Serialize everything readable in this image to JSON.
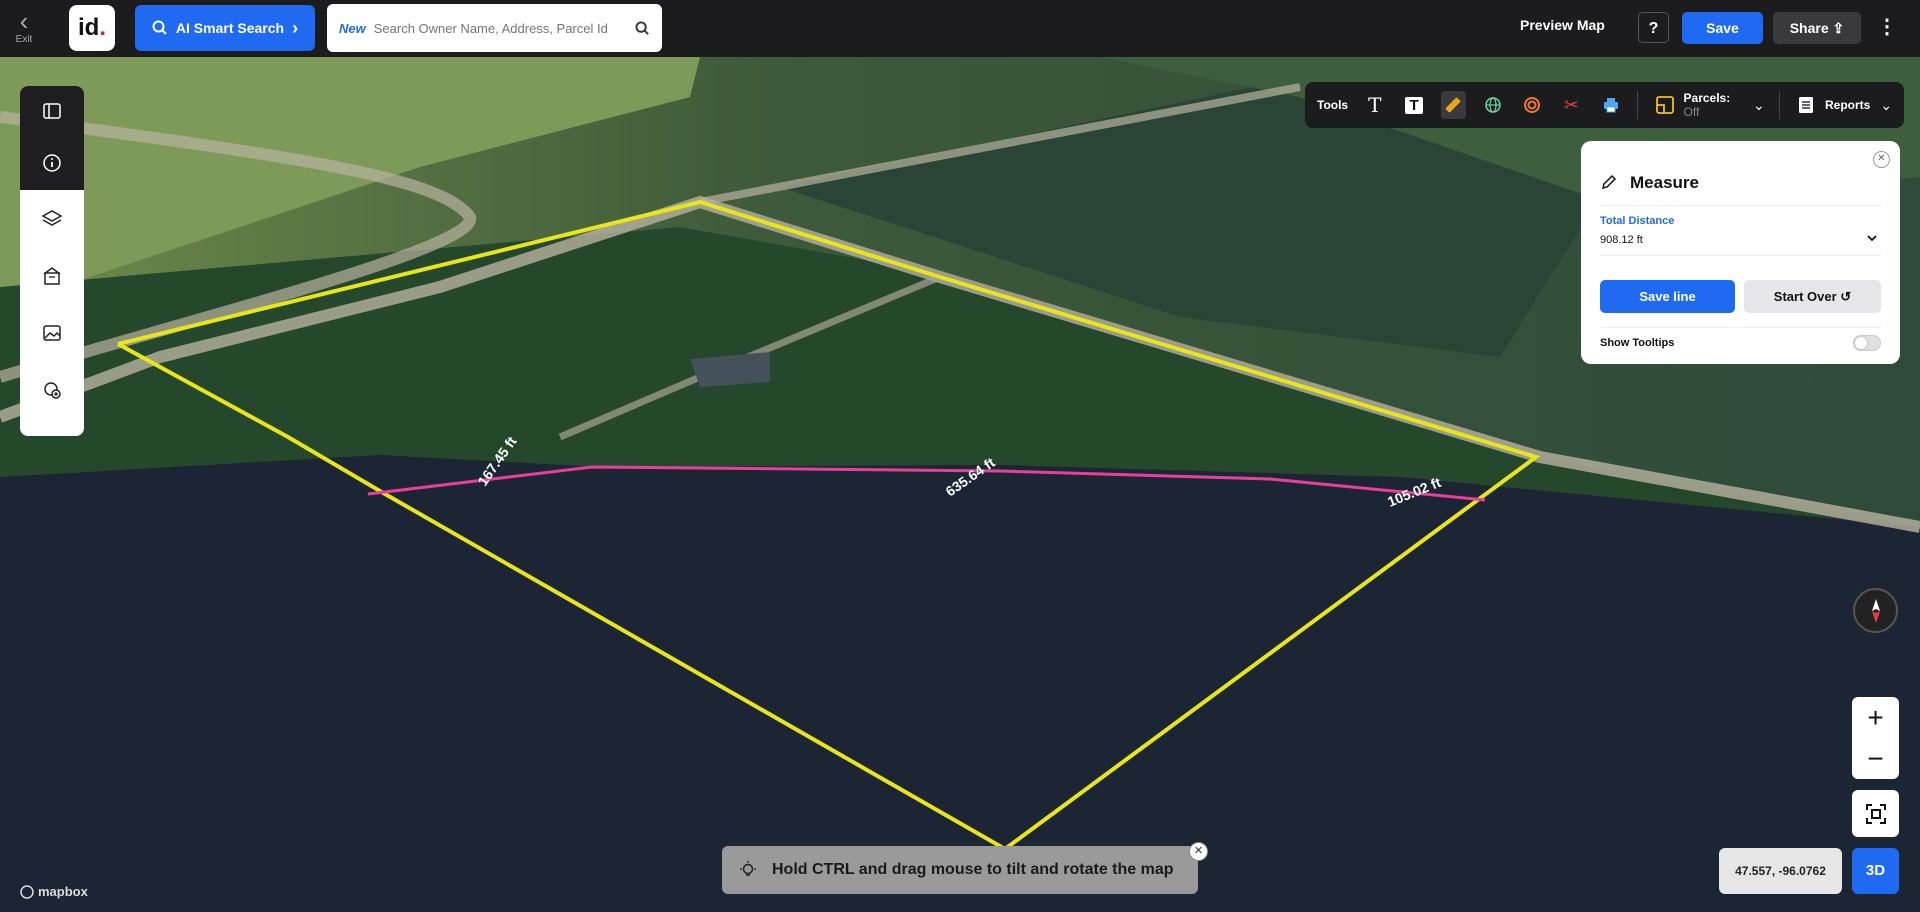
{
  "header": {
    "exit_label": "Exit",
    "logo_text": "id",
    "ai_search_label": "AI Smart Search",
    "search_new_tag": "New",
    "search_placeholder": "Search Owner Name, Address, Parcel Id",
    "preview_label": "Preview Map",
    "help_label": "?",
    "save_label": "Save",
    "share_label": "Share"
  },
  "toolbar": {
    "tools_label": "Tools",
    "parcels_label": "Parcels:",
    "parcels_state": "Off",
    "reports_label": "Reports"
  },
  "measure": {
    "title": "Measure",
    "total_distance_label": "Total Distance",
    "total_distance_value": "908.12 ft",
    "save_line_label": "Save line",
    "start_over_label": "Start Over",
    "show_tooltips_label": "Show Tooltips",
    "show_tooltips_on": false
  },
  "map": {
    "segment_labels": [
      "167.45 ft",
      "635.64 ft",
      "105.02 ft"
    ],
    "hint_text": "Hold CTRL and drag mouse to tilt and rotate the map",
    "coordinates": "47.557, -96.0762",
    "view_mode_label": "3D",
    "attribution": "mapbox"
  },
  "colors": {
    "accent": "#1f6af0",
    "parcel_line": "#e8e61a",
    "measure_line": "#e8409a",
    "water": "#1b2533"
  }
}
